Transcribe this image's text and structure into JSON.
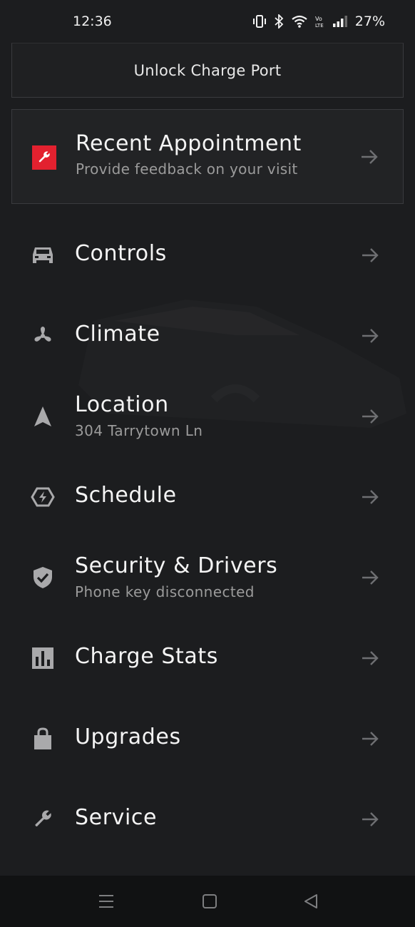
{
  "status_bar": {
    "time": "12:36",
    "battery": "27%",
    "icons": [
      "vibrate-icon",
      "bluetooth-icon",
      "wifi-icon",
      "volte-icon",
      "signal-icon"
    ]
  },
  "unlock_button": {
    "label": "Unlock Charge Port"
  },
  "appointment": {
    "icon": "wrench-icon",
    "title": "Recent Appointment",
    "subtitle": "Provide feedback on your visit",
    "accent": "#e3212f"
  },
  "menu": [
    {
      "icon": "car-icon",
      "label": "Controls"
    },
    {
      "icon": "fan-icon",
      "label": "Climate"
    },
    {
      "icon": "navigation-arrow-icon",
      "label": "Location",
      "subtitle": "304 Tarrytown Ln"
    },
    {
      "icon": "schedule-bolt-icon",
      "label": "Schedule"
    },
    {
      "icon": "shield-check-icon",
      "label": "Security & Drivers",
      "subtitle": "Phone key disconnected"
    },
    {
      "icon": "bar-chart-icon",
      "label": "Charge Stats"
    },
    {
      "icon": "shopping-bag-icon",
      "label": "Upgrades"
    },
    {
      "icon": "wrench-icon",
      "label": "Service"
    }
  ],
  "nav": [
    "recent-apps-icon",
    "home-icon",
    "back-icon"
  ],
  "colors": {
    "background": "#1c1d1f",
    "text": "#f4f4f4",
    "muted": "#9b9b9b",
    "accent": "#e3212f"
  }
}
